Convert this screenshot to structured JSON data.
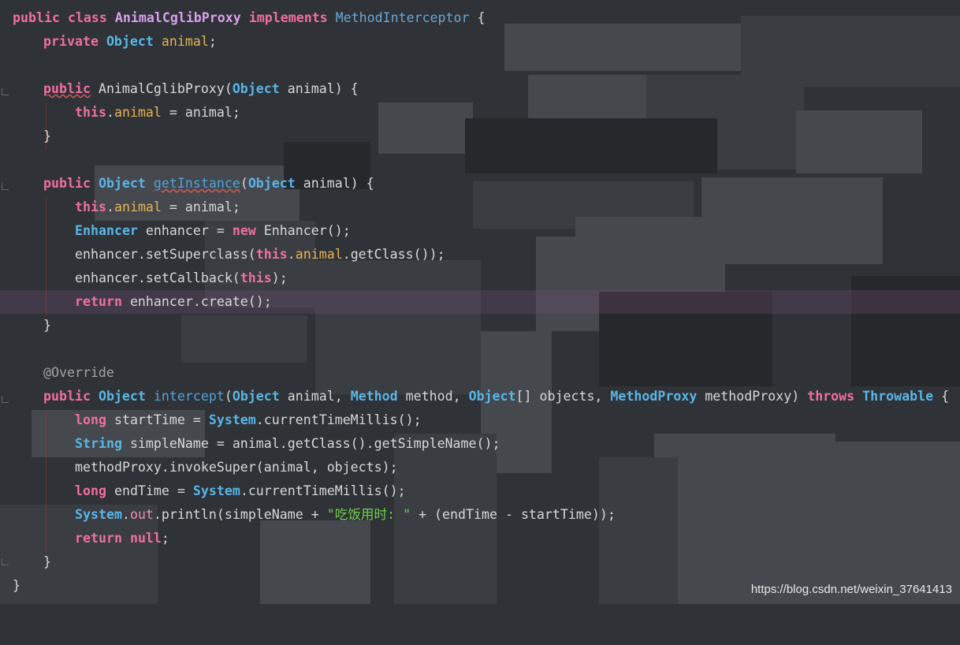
{
  "watermark": "https://blog.csdn.net/weixin_37641413",
  "code": {
    "l1": {
      "public": "public",
      "class": "class",
      "name": "AnimalCglibProxy",
      "implements": "implements",
      "iface": "MethodInterceptor",
      "brace": " {"
    },
    "l2": {
      "private": "private",
      "type": "Object",
      "field": "animal",
      "semi": ";"
    },
    "l4": {
      "public": "public",
      "name": "AnimalCglibProxy",
      "paren": "(",
      "type": "Object",
      "rest": " animal) {"
    },
    "l5": {
      "this": "this",
      "dot": ".",
      "field": "animal",
      "rest": " = animal;"
    },
    "l6": {
      "brace": "}"
    },
    "l8": {
      "public": "public",
      "type": "Object",
      "method": "getInstance",
      "paren": "(",
      "ptype": "Object",
      "rest": " animal) {"
    },
    "l9": {
      "this": "this",
      "dot": ".",
      "field": "animal",
      "rest": " = animal;"
    },
    "l10": {
      "type": "Enhancer",
      "mid": " enhancer = ",
      "new": "new",
      "rest": " Enhancer();"
    },
    "l11": {
      "pre": "enhancer.setSuperclass(",
      "this": "this",
      "dot": ".",
      "field": "animal",
      "rest": ".getClass());"
    },
    "l12": {
      "pre": "enhancer.setCallback(",
      "this": "this",
      "rest": ");"
    },
    "l13": {
      "return": "return",
      "rest": " enhancer.create();"
    },
    "l14": {
      "brace": "}"
    },
    "l16": {
      "ann": "@Override"
    },
    "l17": {
      "public": "public",
      "type": "Object",
      "method": "intercept",
      "p1": "(",
      "t1": "Object",
      "p2": " animal, ",
      "t2": "Method",
      "p3": " method, ",
      "t3": "Object",
      "p4": "[] objects, ",
      "t4": "MethodProxy",
      "p5": " methodProxy) ",
      "throws": "throws",
      "t5": "Throwable",
      "brace": " {"
    },
    "l18": {
      "long": "long",
      "mid": " startTime = ",
      "sys": "System",
      "rest": ".currentTimeMillis();"
    },
    "l19": {
      "type": "String",
      "rest": " simpleName = animal.getClass().getSimpleName();"
    },
    "l20": {
      "text": "methodProxy.invokeSuper(animal, objects);"
    },
    "l21": {
      "long": "long",
      "mid": " endTime = ",
      "sys": "System",
      "rest": ".currentTimeMillis();"
    },
    "l22": {
      "sys": "System",
      "dot": ".",
      "out": "out",
      "mid": ".println(simpleName + ",
      "str": "\"吃饭用时: \"",
      "rest": " + (endTime - startTime));"
    },
    "l23": {
      "return": "return",
      "null": "null",
      "semi": ";"
    },
    "l24": {
      "brace": "}"
    },
    "l25": {
      "brace": "}"
    }
  }
}
